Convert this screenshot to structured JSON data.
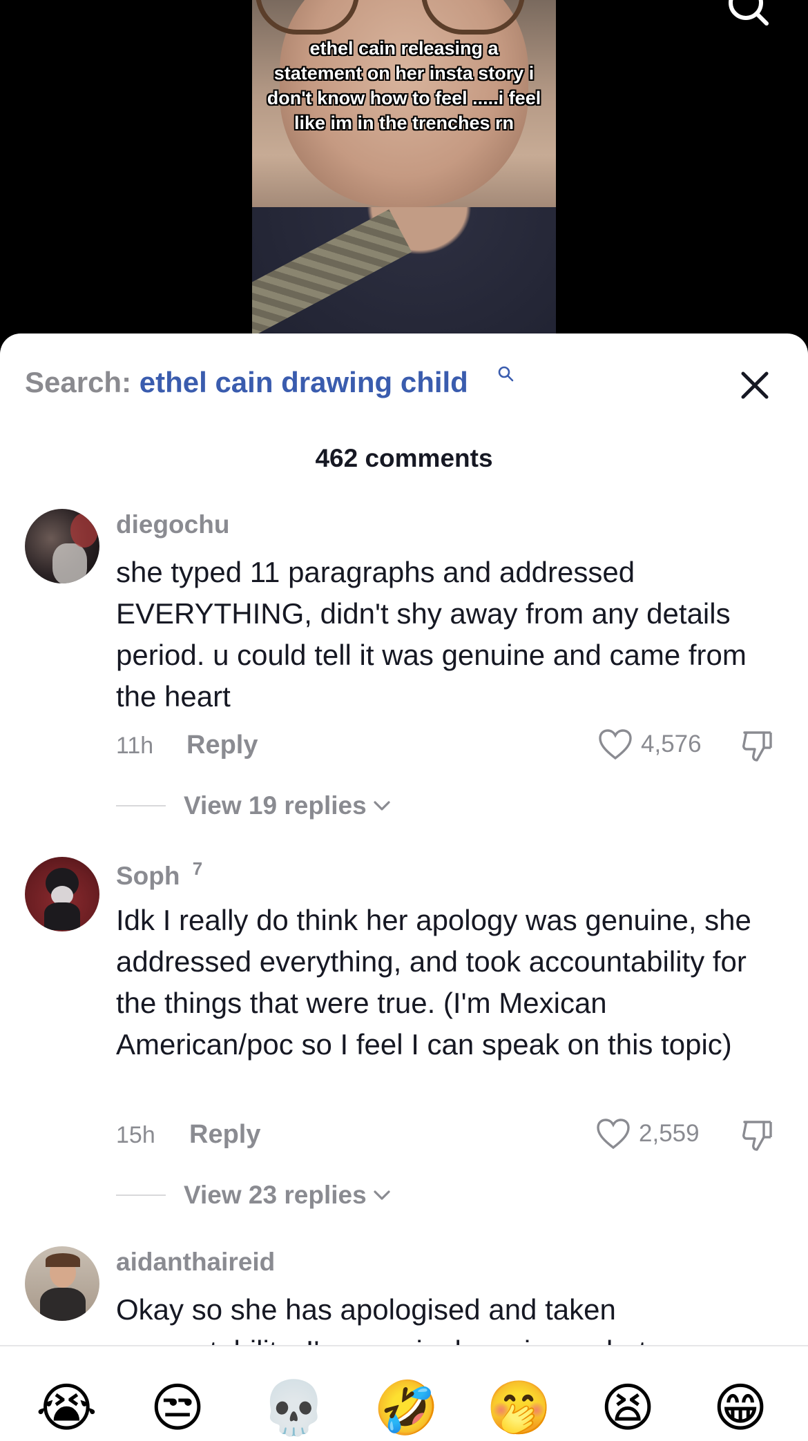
{
  "video": {
    "caption": "ethel cain releasing a statement on her insta story i don't know how to feel .....i feel like im in the trenches rn"
  },
  "sheet": {
    "search_label": "Search:",
    "search_query": "ethel cain drawing child",
    "comment_count": "462 comments"
  },
  "comments": [
    {
      "username": "diegochu",
      "text": "she typed 11 paragraphs and addressed EVERYTHING, didn't shy away from any details period. u could tell it was genuine and came from the heart",
      "time": "11h",
      "reply_label": "Reply",
      "likes": "4,576",
      "view_replies": "View 19 replies"
    },
    {
      "username": "Soph",
      "badge": "7",
      "text": "Idk I really do think her apology was genuine, she addressed everything, and took accountability for the things that were true. (I'm Mexican American/poc so I feel I can speak on this topic)",
      "time": "15h",
      "reply_label": "Reply",
      "likes": "2,559",
      "view_replies": "View 23 replies"
    },
    {
      "username": "aidanthaireid",
      "text": "Okay so she has apologised and taken accountability. I'm genuinely curious what"
    }
  ],
  "emoji_bar": [
    "😭",
    "😒",
    "💀",
    "🤣",
    "🤭",
    "😫",
    "😁"
  ],
  "colors": {
    "accent_link": "#3a5cae",
    "secondary_text": "#8a8b91",
    "primary_text": "#161823"
  }
}
